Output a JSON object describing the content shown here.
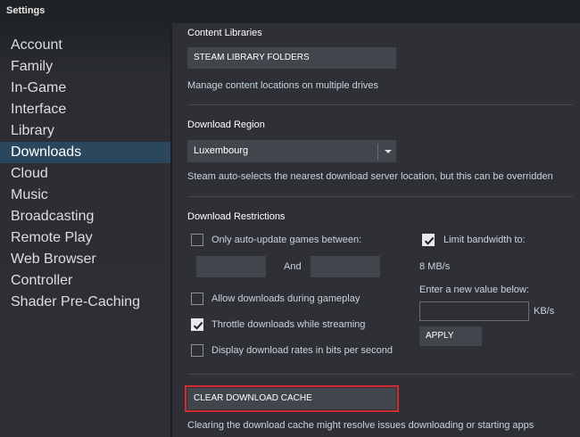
{
  "window": {
    "title": "Settings"
  },
  "sidebar": {
    "items": [
      {
        "label": "Account",
        "active": false
      },
      {
        "label": "Family",
        "active": false
      },
      {
        "label": "In-Game",
        "active": false
      },
      {
        "label": "Interface",
        "active": false
      },
      {
        "label": "Library",
        "active": false
      },
      {
        "label": "Downloads",
        "active": true
      },
      {
        "label": "Cloud",
        "active": false
      },
      {
        "label": "Music",
        "active": false
      },
      {
        "label": "Broadcasting",
        "active": false
      },
      {
        "label": "Remote Play",
        "active": false
      },
      {
        "label": "Web Browser",
        "active": false
      },
      {
        "label": "Controller",
        "active": false
      },
      {
        "label": "Shader Pre-Caching",
        "active": false
      }
    ]
  },
  "content_libraries": {
    "title": "Content Libraries",
    "button_label": "STEAM LIBRARY FOLDERS",
    "description": "Manage content locations on multiple drives"
  },
  "download_region": {
    "title": "Download Region",
    "selected": "Luxembourg",
    "description": "Steam auto-selects the nearest download server location, but this can be overridden"
  },
  "download_restrictions": {
    "title": "Download Restrictions",
    "auto_update_label": "Only auto-update games between:",
    "auto_update_checked": false,
    "between_start": "",
    "and_label": "And",
    "between_end": "",
    "allow_during_gameplay_label": "Allow downloads during gameplay",
    "allow_during_gameplay_checked": false,
    "throttle_label": "Throttle downloads while streaming",
    "throttle_checked": true,
    "bits_label": "Display download rates in bits per second",
    "bits_checked": false,
    "limit_bandwidth_label": "Limit bandwidth to:",
    "limit_bandwidth_checked": true,
    "current_limit": "8 MB/s",
    "new_value_label": "Enter a new value below:",
    "new_value": "",
    "unit_label": "KB/s",
    "apply_label": "APPLY"
  },
  "cache": {
    "button_label": "CLEAR DOWNLOAD CACHE",
    "description": "Clearing the download cache might resolve issues downloading or starting apps",
    "highlight_color": "#d42a35"
  },
  "colors": {
    "background": "#2e3035",
    "sidebar_active": "#2a475e",
    "button": "#41464d",
    "text": "#c6d4df"
  }
}
